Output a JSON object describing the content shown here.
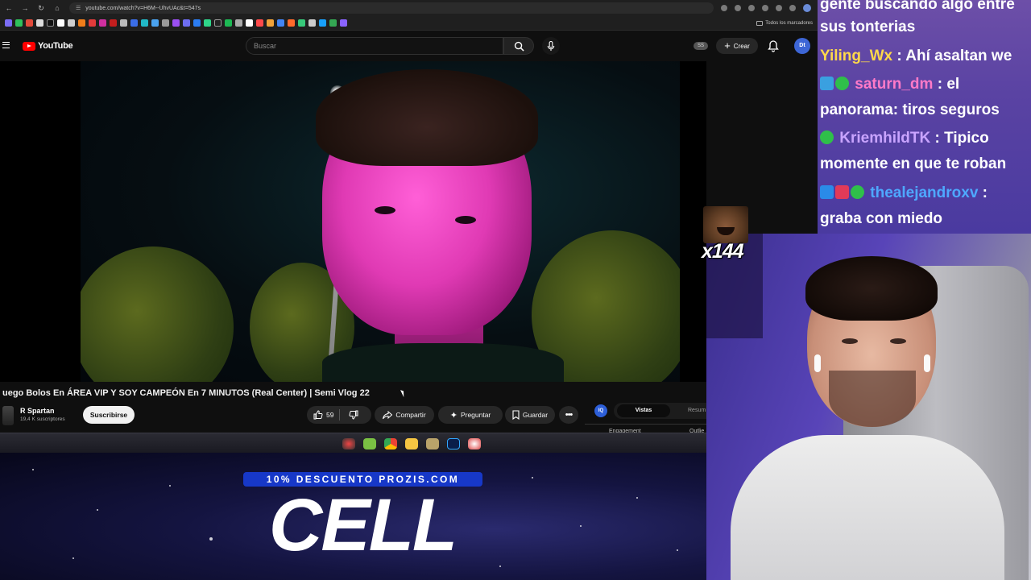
{
  "browser": {
    "url": "youtube.com/watch?v=H6M--UhvUAc&t=547s",
    "bookmarks_folder": "Todos los marcadores"
  },
  "youtube": {
    "logo_text": "YouTube",
    "search_placeholder": "Buscar",
    "ss_badge": "SS",
    "create_label": "Crear",
    "avatar_text": "Dt"
  },
  "video": {
    "title": "uego Bolos En ÁREA VIP Y SOY CAMPEÓN En 7 MINUTOS (Real Center) | Semi Vlog 22",
    "channel_name": "R Spartan",
    "subscribers": "19,4 K suscriptores",
    "subscribe_label": "Suscribirse",
    "likes": "59",
    "share_label": "Compartir",
    "ask_label": "Preguntar",
    "save_label": "Guardar"
  },
  "side_panel": {
    "icon_text": "IQ",
    "tab_views": "Vistas",
    "tab_summary": "Resum",
    "tab_engagement": "Engagement",
    "tab_outliers": "Outlie"
  },
  "sponsor": {
    "promo": "10% DESCUENTO PROZIS.COM",
    "brand": "CELL"
  },
  "chat": {
    "lines": [
      {
        "text": "gente buscando algo entre"
      },
      {
        "text": "sus tonterias"
      },
      {
        "user": "Yiling_Wx",
        "sep": " : ",
        "text": "Ahí asaltan we",
        "color": "#ffd84a"
      },
      {
        "user": "saturn_dm",
        "sep": " : ",
        "text": "el",
        "color": "#ff7ac8"
      },
      {
        "text": "panorama: tiros seguros"
      },
      {
        "user": "KriemhildTK",
        "sep": " : ",
        "text": "Tipico",
        "color": "#c9a4ff"
      },
      {
        "text": "momente en que te roban"
      },
      {
        "user": "thealejandroxv",
        "sep": " :",
        "text": "",
        "color": "#4ea8ff"
      },
      {
        "text": "graba con miedo"
      }
    ]
  },
  "emote": {
    "count": "x144"
  },
  "colors": {
    "youtube_red": "#ff0000",
    "subscribe_bg": "#f1f1f1",
    "chat_bg": "#5a43a3",
    "promo_blue": "#1738c8"
  },
  "icons": [
    "back-icon",
    "forward-icon",
    "reload-icon",
    "home-icon",
    "search-icon",
    "mic-icon",
    "plus-icon",
    "bell-icon",
    "thumbs-up-icon",
    "thumbs-down-icon",
    "share-icon",
    "sparkle-icon",
    "bookmark-icon",
    "more-icon"
  ]
}
